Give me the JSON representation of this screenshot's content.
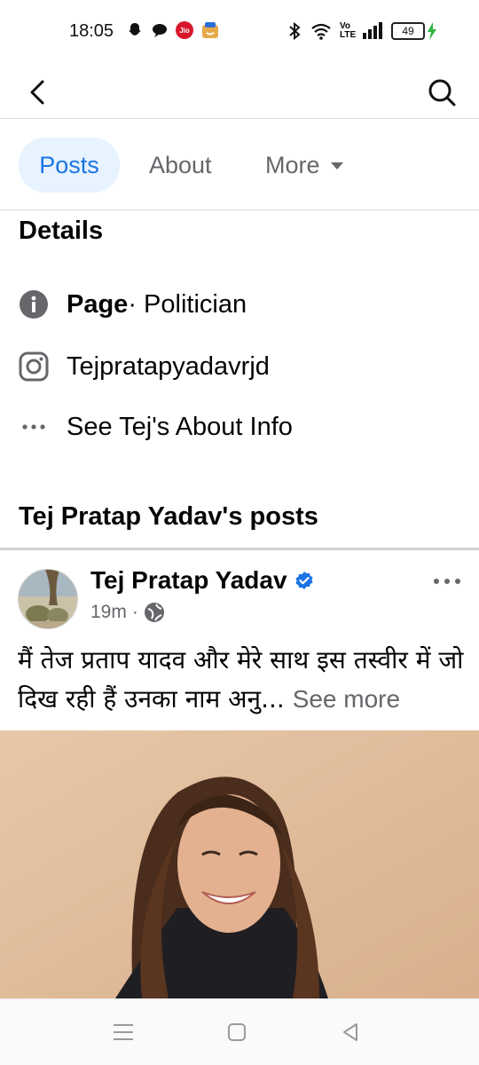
{
  "status_bar": {
    "time": "18:05",
    "left_icons": [
      "snapchat-icon",
      "message-bubble-icon",
      "jio-icon",
      "shopping-app-icon"
    ],
    "jio_label": "Jio",
    "right_icons": [
      "bluetooth-icon",
      "wifi-icon",
      "volte-icon",
      "signal-icon",
      "battery-icon"
    ],
    "volte_label": "Vo LTE",
    "battery": "49"
  },
  "top_bar": {
    "back_icon": "chevron-left-icon",
    "search_icon": "search-icon"
  },
  "tabs": {
    "posts": "Posts",
    "about": "About",
    "more": "More",
    "active": "Posts",
    "active_color": "#1b74e4"
  },
  "details": {
    "title": "Details",
    "page_label": "Page",
    "page_category": " · Politician",
    "instagram": "Tejpratapyadavrjd",
    "about_link": "See Tej's About Info"
  },
  "posts_section": {
    "title": "Tej Pratap Yadav's posts"
  },
  "post": {
    "author": "Tej Pratap Yadav",
    "time": "19m",
    "meta_sep": "·",
    "privacy_icon": "globe-icon",
    "verified_color": "#1b74e4",
    "text": "मैं तेज प्रताप यादव और  मेरे साथ इस तस्वीर में जो दिख रही हैं उनका नाम अनु...",
    "see_more": "See more"
  },
  "nav_bar": {
    "icons": [
      "menu-lines-icon",
      "home-square-icon",
      "back-triangle-icon"
    ]
  }
}
